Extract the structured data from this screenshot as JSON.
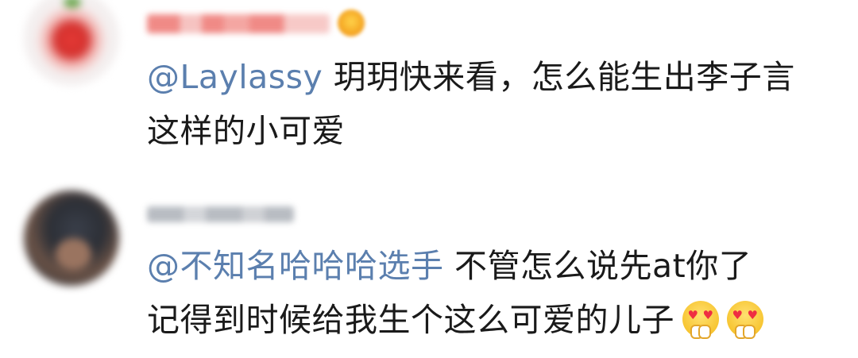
{
  "comments": [
    {
      "mention": "@Laylassy",
      "line1": " 玥玥快来看，怎么能生出李子言",
      "line2": "这样的小可爱",
      "avatar": "strawberry-avatar-blurred",
      "badge_icon": "vip-crown-badge-icon"
    },
    {
      "mention": "@不知名哈哈哈选手",
      "line1": " 不管怎么说先at你了",
      "line2": "记得到时候给我生个这么可爱的儿子",
      "avatar": "dark-portrait-avatar-blurred",
      "emojis": [
        "heart-eyes-emoji-icon",
        "heart-eyes-emoji-icon"
      ]
    }
  ],
  "colors": {
    "mention": "#5b7fae",
    "text": "#1a1a1a",
    "background": "#ffffff"
  }
}
